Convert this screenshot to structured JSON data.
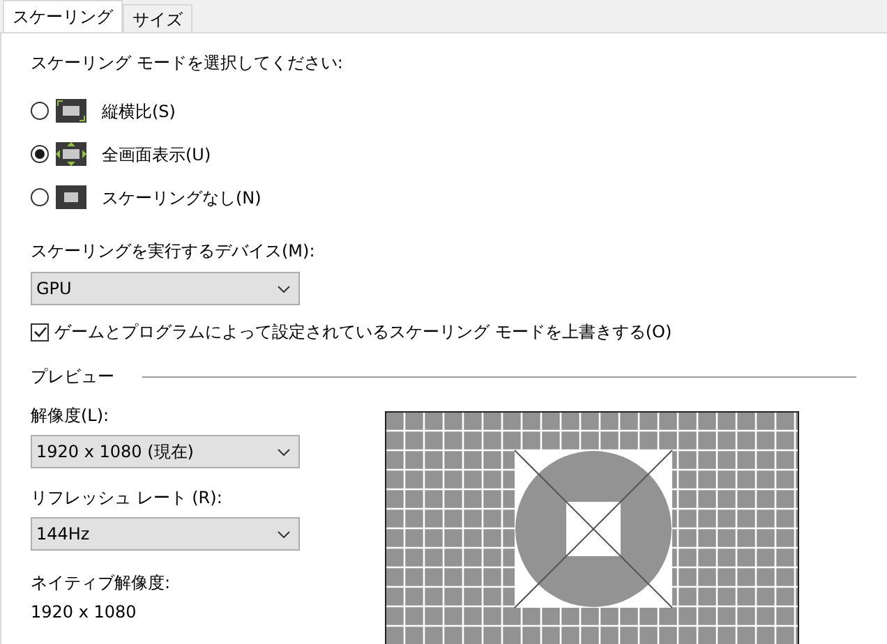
{
  "tabs": [
    {
      "label": "スケーリング",
      "selected": true
    },
    {
      "label": "サイズ",
      "selected": false
    }
  ],
  "mode_prompt": "スケーリング モードを選択してください:",
  "modes": [
    {
      "kind": "aspect",
      "label": "縦横比(S)",
      "selected": false
    },
    {
      "kind": "full",
      "label": "全画面表示(U)",
      "selected": true
    },
    {
      "kind": "none",
      "label": "スケーリングなし(N)",
      "selected": false
    }
  ],
  "device": {
    "label": "スケーリングを実行するデバイス(M):",
    "value": "GPU"
  },
  "override": {
    "label": "ゲームとプログラムによって設定されているスケーリング モードを上書きする(O)",
    "checked": true
  },
  "preview": {
    "title": "プレビュー",
    "resolution": {
      "label": "解像度(L):",
      "value": "1920 x 1080 (現在)"
    },
    "refresh": {
      "label": "リフレッシュ レート (R):",
      "value": "144Hz"
    },
    "native": {
      "label": "ネイティブ解像度:",
      "value": "1920 x 1080"
    }
  }
}
